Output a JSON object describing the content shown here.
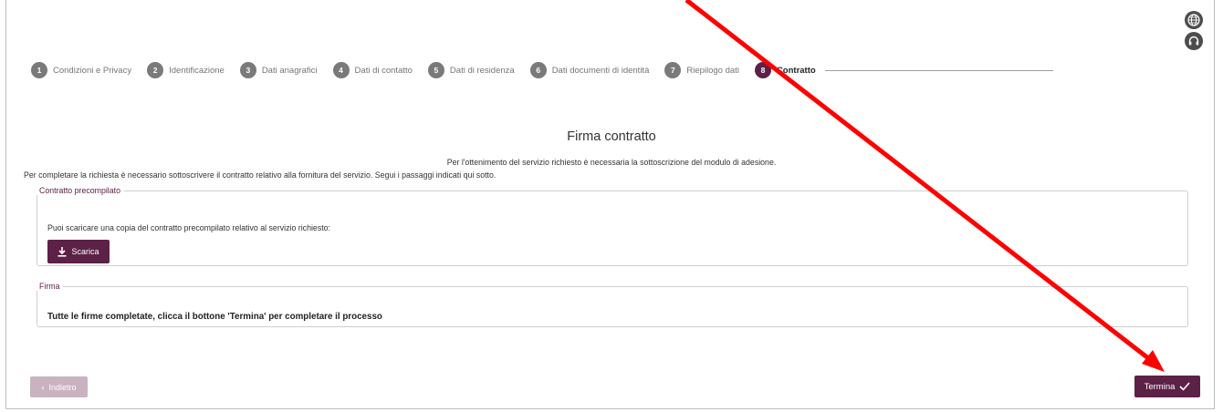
{
  "stepper": {
    "steps": [
      {
        "num": "1",
        "label": "Condizioni e Privacy"
      },
      {
        "num": "2",
        "label": "Identificazione"
      },
      {
        "num": "3",
        "label": "Dati anagrafici"
      },
      {
        "num": "4",
        "label": "Dati di contatto"
      },
      {
        "num": "5",
        "label": "Dati di residenza"
      },
      {
        "num": "6",
        "label": "Dati documenti di identità"
      },
      {
        "num": "7",
        "label": "Riepilogo dati"
      },
      {
        "num": "8",
        "label": "Contratto"
      }
    ],
    "active_step": 8
  },
  "top_icons": [
    "globe-icon",
    "headset-icon"
  ],
  "page": {
    "title": "Firma contratto",
    "intro_line1": "Per l'ottenimento del servizio richiesto è necessaria la sottoscrizione del modulo di adesione.",
    "intro_line2": "Per completare la richiesta è necessario sottoscrivere il contratto relativo alla fornitura del servizio. Segui i passaggi indicati qui sotto."
  },
  "precompiled": {
    "legend": "Contratto precompilato",
    "text": "Puoi scaricare una copia del contratto precompilato relativo al servizio richiesto:",
    "download_label": "Scarica"
  },
  "signature": {
    "legend": "Firma",
    "text": "Tutte le firme completate, clicca il bottone 'Termina' per completare il processo"
  },
  "footer": {
    "back_label": "Indietro",
    "finish_label": "Termina"
  },
  "colors": {
    "accent": "#5c2146",
    "accent_disabled": "#c9b3c1",
    "annotation_arrow": "#ff0000"
  }
}
